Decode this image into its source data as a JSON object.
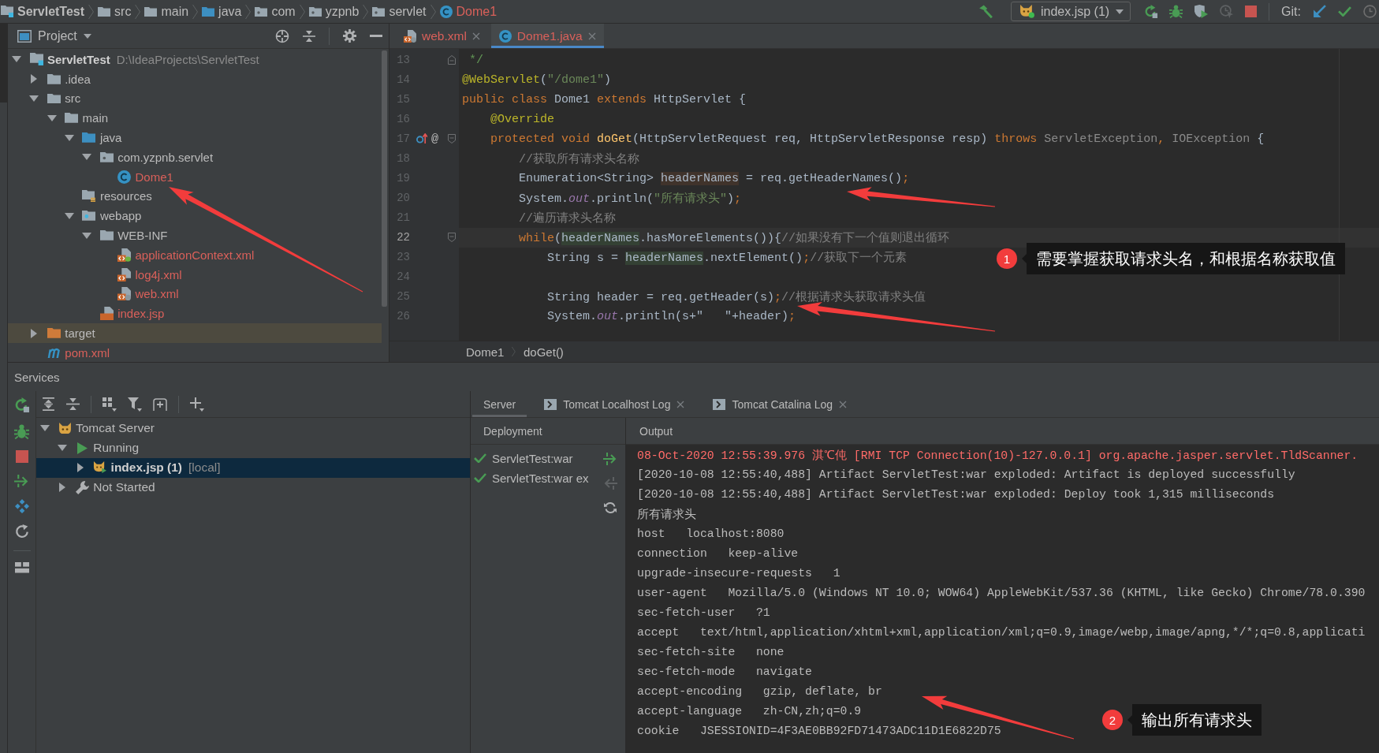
{
  "breadcrumb": [
    {
      "label": "ServletTest",
      "kind": "project",
      "untracked": false
    },
    {
      "label": "src",
      "kind": "folder",
      "untracked": false
    },
    {
      "label": "main",
      "kind": "folder",
      "untracked": false
    },
    {
      "label": "java",
      "kind": "source",
      "untracked": false
    },
    {
      "label": "com",
      "kind": "package",
      "untracked": false
    },
    {
      "label": "yzpnb",
      "kind": "package",
      "untracked": false
    },
    {
      "label": "servlet",
      "kind": "package",
      "untracked": false
    },
    {
      "label": "Dome1",
      "kind": "class",
      "untracked": true
    }
  ],
  "toolbar": {
    "run_config": "index.jsp (1)",
    "vcs_label": "Git:"
  },
  "project": {
    "title": "Project",
    "tree": [
      {
        "label": "ServletTest",
        "path": "D:\\IdeaProjects\\ServletTest",
        "kind": "project",
        "expanded": true,
        "untracked": false,
        "highlighted": false,
        "children": [
          {
            "label": ".idea",
            "kind": "folder",
            "expanded": false,
            "untracked": false,
            "highlighted": false
          },
          {
            "label": "src",
            "kind": "folder",
            "expanded": true,
            "untracked": false,
            "highlighted": false,
            "children": [
              {
                "label": "main",
                "kind": "folder",
                "expanded": true,
                "untracked": false,
                "highlighted": false,
                "children": [
                  {
                    "label": "java",
                    "kind": "source",
                    "expanded": true,
                    "untracked": false,
                    "highlighted": false,
                    "children": [
                      {
                        "label": "com.yzpnb.servlet",
                        "kind": "package",
                        "expanded": true,
                        "untracked": false,
                        "highlighted": false,
                        "children": [
                          {
                            "label": "Dome1",
                            "kind": "class",
                            "untracked": true,
                            "highlighted": false
                          }
                        ]
                      }
                    ]
                  },
                  {
                    "label": "resources",
                    "kind": "resources",
                    "untracked": false,
                    "highlighted": false
                  },
                  {
                    "label": "webapp",
                    "kind": "web",
                    "expanded": true,
                    "untracked": false,
                    "highlighted": false,
                    "children": [
                      {
                        "label": "WEB-INF",
                        "kind": "folder",
                        "expanded": true,
                        "untracked": false,
                        "highlighted": false,
                        "children": [
                          {
                            "label": "applicationContext.xml",
                            "kind": "spring-xml",
                            "untracked": true,
                            "highlighted": false
                          },
                          {
                            "label": "log4j.xml",
                            "kind": "xml",
                            "untracked": true,
                            "highlighted": false
                          },
                          {
                            "label": "web.xml",
                            "kind": "web-xml",
                            "untracked": true,
                            "highlighted": false
                          }
                        ]
                      },
                      {
                        "label": "index.jsp",
                        "kind": "jsp",
                        "untracked": true,
                        "highlighted": false
                      }
                    ]
                  }
                ]
              }
            ]
          },
          {
            "label": "target",
            "kind": "excluded",
            "expanded": false,
            "untracked": false,
            "highlighted": true
          },
          {
            "label": "pom.xml",
            "kind": "maven",
            "untracked": true,
            "highlighted": false
          }
        ]
      }
    ]
  },
  "editor": {
    "tabs": [
      {
        "label": "web.xml",
        "kind": "web-xml",
        "selected": false,
        "untracked": true
      },
      {
        "label": "Dome1.java",
        "kind": "class",
        "selected": true,
        "untracked": true
      }
    ],
    "lines": [
      {
        "number": "13",
        "current": false,
        "fold": {
          "kind": "end"
        },
        "tokens": [
          {
            "text": " */",
            "kind": "doc"
          }
        ]
      },
      {
        "number": "14",
        "current": false,
        "tokens": [
          {
            "text": "@WebServlet",
            "kind": "annotation"
          },
          {
            "text": "(",
            "kind": "plain"
          },
          {
            "text": "\"/dome1\"",
            "kind": "string"
          },
          {
            "text": ")",
            "kind": "plain"
          }
        ]
      },
      {
        "number": "15",
        "current": false,
        "tokens": [
          {
            "text": "public class ",
            "kind": "keyword"
          },
          {
            "text": "Dome1 ",
            "kind": "plain"
          },
          {
            "text": "extends ",
            "kind": "keyword"
          },
          {
            "text": "HttpServlet {",
            "kind": "plain"
          }
        ]
      },
      {
        "number": "16",
        "current": false,
        "tokens": [
          {
            "text": "    @Override",
            "kind": "annotation"
          }
        ]
      },
      {
        "number": "17",
        "current": false,
        "fold": {
          "kind": "start"
        },
        "gutter_icons": [
          {
            "kind": "override"
          }
        ],
        "gutter_text": "@",
        "tokens": [
          {
            "text": "    protected void ",
            "kind": "keyword"
          },
          {
            "text": "doGet",
            "kind": "method"
          },
          {
            "text": "(HttpServletRequest req, HttpServletResponse resp) ",
            "kind": "plain"
          },
          {
            "text": "throws ",
            "kind": "keyword"
          },
          {
            "text": "ServletException",
            "kind": "muted"
          },
          {
            "text": ", ",
            "kind": "keyword"
          },
          {
            "text": "IOException",
            "kind": "muted"
          },
          {
            "text": " {",
            "kind": "plain"
          }
        ]
      },
      {
        "number": "18",
        "current": false,
        "tokens": [
          {
            "text": "        //获取所有请求头名称",
            "kind": "comment"
          }
        ]
      },
      {
        "number": "19",
        "current": false,
        "tokens": [
          {
            "text": "        Enumeration<String> ",
            "kind": "plain"
          },
          {
            "text": "headerNames",
            "kind": "write"
          },
          {
            "text": " = req.getHeaderNames()",
            "kind": "plain"
          },
          {
            "text": ";",
            "kind": "keyword"
          }
        ]
      },
      {
        "number": "20",
        "current": false,
        "tokens": [
          {
            "text": "        System.",
            "kind": "plain"
          },
          {
            "text": "out",
            "kind": "field"
          },
          {
            "text": ".println(",
            "kind": "plain"
          },
          {
            "text": "\"所有请求头\"",
            "kind": "string"
          },
          {
            "text": ")",
            "kind": "plain"
          },
          {
            "text": ";",
            "kind": "keyword"
          }
        ]
      },
      {
        "number": "21",
        "current": false,
        "tokens": [
          {
            "text": "        //遍历请求头名称",
            "kind": "comment"
          }
        ]
      },
      {
        "number": "22",
        "current": true,
        "fold": {
          "kind": "start"
        },
        "tokens": [
          {
            "text": "        while",
            "kind": "keyword"
          },
          {
            "text": "(",
            "kind": "plain"
          },
          {
            "text": "headerNames",
            "kind": "read"
          },
          {
            "text": ".hasMoreElements()){",
            "kind": "plain"
          },
          {
            "text": "//如果没有下一个值则退出循环",
            "kind": "comment"
          }
        ]
      },
      {
        "number": "23",
        "current": false,
        "tokens": [
          {
            "text": "            String s = ",
            "kind": "plain"
          },
          {
            "text": "headerNames",
            "kind": "read"
          },
          {
            "text": ".nextElement()",
            "kind": "plain"
          },
          {
            "text": ";",
            "kind": "keyword"
          },
          {
            "text": "//获取下一个元素",
            "kind": "comment"
          }
        ]
      },
      {
        "number": "24",
        "current": false
      },
      {
        "number": "25",
        "current": false,
        "tokens": [
          {
            "text": "            String header = req.getHeader(s)",
            "kind": "plain"
          },
          {
            "text": ";",
            "kind": "keyword"
          },
          {
            "text": "//根据请求头获取请求头值",
            "kind": "comment"
          }
        ]
      },
      {
        "number": "26",
        "current": false,
        "tokens": [
          {
            "text": "            System.",
            "kind": "plain"
          },
          {
            "text": "out",
            "kind": "field"
          },
          {
            "text": ".println(s+\"   \"+header)",
            "kind": "plain"
          },
          {
            "text": ";",
            "kind": "keyword"
          }
        ]
      }
    ],
    "breadcrumb": [
      "Dome1",
      "doGet()"
    ]
  },
  "services": {
    "title": "Services",
    "tree": [
      {
        "label": "Tomcat Server",
        "kind": "server",
        "expanded": true,
        "selected": false,
        "children": [
          {
            "label": "Running",
            "kind": "running",
            "expanded": true,
            "selected": false,
            "children": [
              {
                "label": "index.jsp (1)",
                "suffix": "[local]",
                "kind": "deployment",
                "expanded": false,
                "selected": true
              }
            ]
          },
          {
            "label": "Not Started",
            "kind": "stopped",
            "expanded": false,
            "selected": false
          }
        ]
      }
    ],
    "tabs": [
      {
        "label": "Server",
        "kind": "server",
        "selected": true,
        "closable": false
      },
      {
        "label": "Tomcat Localhost Log",
        "kind": "log",
        "selected": false,
        "closable": true
      },
      {
        "label": "Tomcat Catalina Log",
        "kind": "log",
        "selected": false,
        "closable": true
      }
    ],
    "deployment": {
      "title": "Deployment",
      "items": [
        {
          "label": "ServletTest:war",
          "deployed": true
        },
        {
          "label": "ServletTest:war ex",
          "deployed": true
        }
      ]
    },
    "output": {
      "title": "Output",
      "lines": [
        {
          "text": "08-Oct-2020 12:55:39.976 淇℃伅 [RMI TCP Connection(10)-127.0.0.1] org.apache.jasper.servlet.TldScanner.",
          "kind": "stderr"
        },
        {
          "text": "[2020-10-08 12:55:40,488] Artifact ServletTest:war exploded: Artifact is deployed successfully",
          "kind": "stdout"
        },
        {
          "text": "[2020-10-08 12:55:40,488] Artifact ServletTest:war exploded: Deploy took 1,315 milliseconds",
          "kind": "stdout"
        },
        {
          "text": "所有请求头",
          "kind": "stdout"
        },
        {
          "text": "host   localhost:8080",
          "kind": "stdout"
        },
        {
          "text": "connection   keep-alive",
          "kind": "stdout"
        },
        {
          "text": "upgrade-insecure-requests   1",
          "kind": "stdout"
        },
        {
          "text": "user-agent   Mozilla/5.0 (Windows NT 10.0; WOW64) AppleWebKit/537.36 (KHTML, like Gecko) Chrome/78.0.390",
          "kind": "stdout"
        },
        {
          "text": "sec-fetch-user   ?1",
          "kind": "stdout"
        },
        {
          "text": "accept   text/html,application/xhtml+xml,application/xml;q=0.9,image/webp,image/apng,*/*;q=0.8,applicati",
          "kind": "stdout"
        },
        {
          "text": "sec-fetch-site   none",
          "kind": "stdout"
        },
        {
          "text": "sec-fetch-mode   navigate",
          "kind": "stdout"
        },
        {
          "text": "accept-encoding   gzip, deflate, br",
          "kind": "stdout"
        },
        {
          "text": "accept-language   zh-CN,zh;q=0.9",
          "kind": "stdout"
        },
        {
          "text": "cookie   JSESSIONID=4F3AE0BB92FD71473ADC11D1E6822D75",
          "kind": "stdout"
        }
      ]
    }
  },
  "annotations": [
    {
      "number": "1",
      "text": "需要掌握获取请求头名，和根据名称获取值"
    },
    {
      "number": "2",
      "text": "输出所有请求头"
    }
  ]
}
